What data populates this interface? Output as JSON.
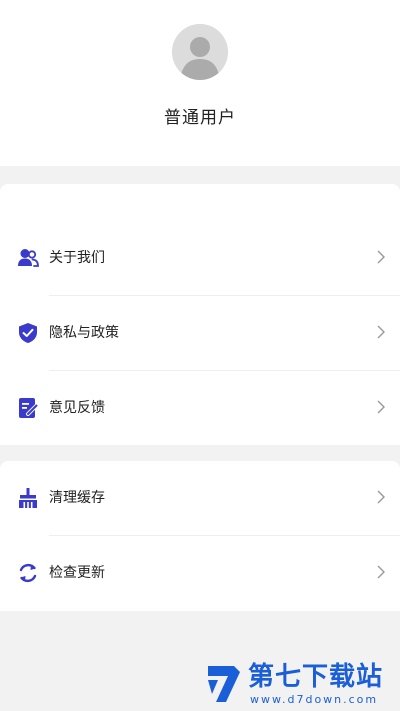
{
  "profile": {
    "username": "普通用户",
    "avatar_icon": "default-avatar-icon"
  },
  "menu_group_1": [
    {
      "label": "关于我们",
      "icon": "users-icon"
    },
    {
      "label": "隐私与政策",
      "icon": "shield-check-icon"
    },
    {
      "label": "意见反馈",
      "icon": "feedback-doc-icon"
    }
  ],
  "menu_group_2": [
    {
      "label": "清理缓存",
      "icon": "broom-icon"
    },
    {
      "label": "检查更新",
      "icon": "refresh-icon"
    }
  ],
  "watermark": {
    "title": "第七下载站",
    "url": "www.d7down.com"
  },
  "colors": {
    "accent": "#3a3acd",
    "watermark": "#1a5fd8",
    "background": "#f2f2f2"
  }
}
